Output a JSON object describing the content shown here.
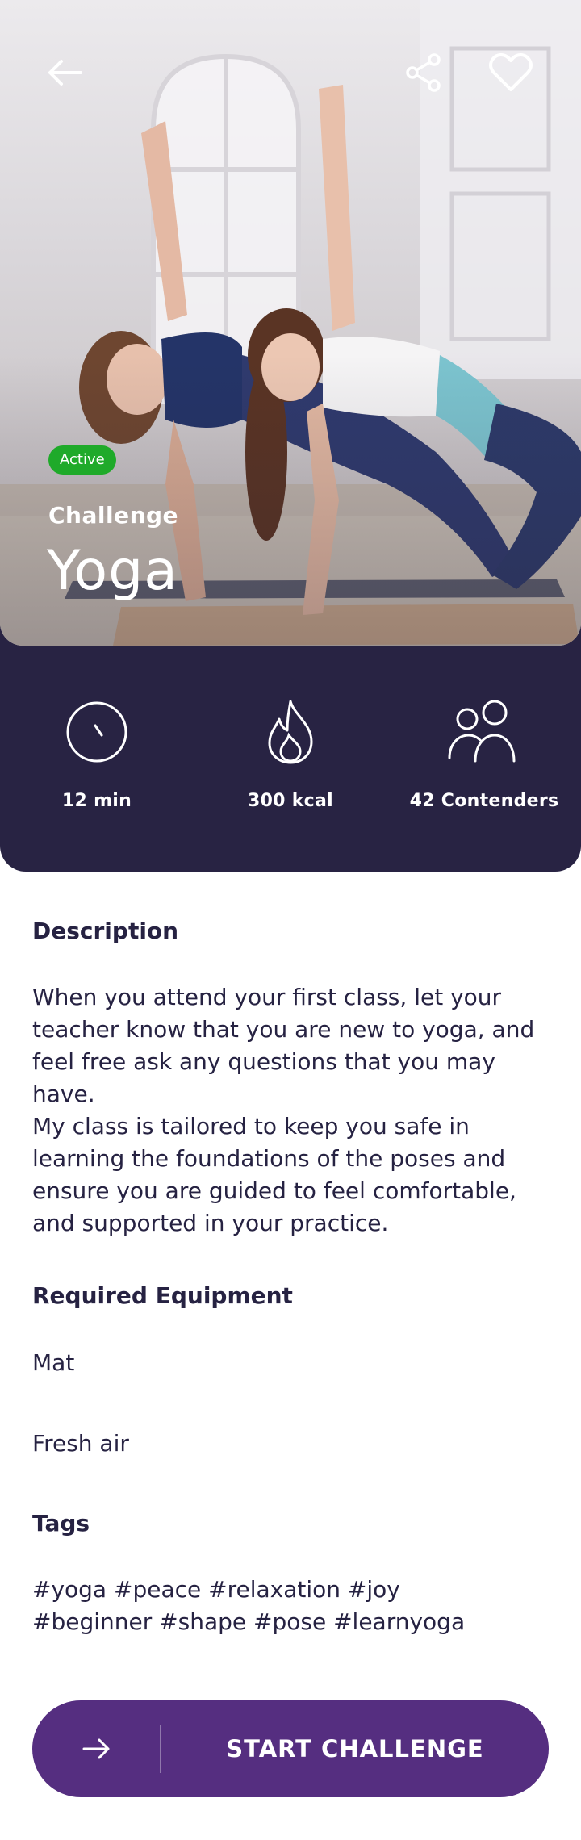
{
  "hero": {
    "badge": "Active",
    "label": "Challenge",
    "title": "Yoga"
  },
  "stats": [
    {
      "icon": "clock-icon",
      "value": "12 min"
    },
    {
      "icon": "flame-icon",
      "value": "300 kcal"
    },
    {
      "icon": "users-icon",
      "value": "42 Contenders"
    }
  ],
  "description": {
    "title": "Description",
    "paragraphs": [
      "When you attend your first class, let your teacher know that you are new to yoga, and feel free ask any questions that you may have.",
      "My class is tailored to keep you safe in learning the foundations of the poses and ensure you are guided to feel comfortable, and supported in your practice."
    ]
  },
  "equipment": {
    "title": "Required Equipment",
    "items": [
      "Mat",
      "Fresh air"
    ]
  },
  "tags": {
    "title": "Tags",
    "text": "#yoga #peace #relaxation #joy #beginner #shape #pose #learnyoga"
  },
  "cta": {
    "label": "START CHALLENGE",
    "icon": "arrow-right-icon"
  },
  "colors": {
    "dark": "#282343",
    "accent": "#552e80",
    "active": "#1faa2a",
    "text": "#262242"
  }
}
